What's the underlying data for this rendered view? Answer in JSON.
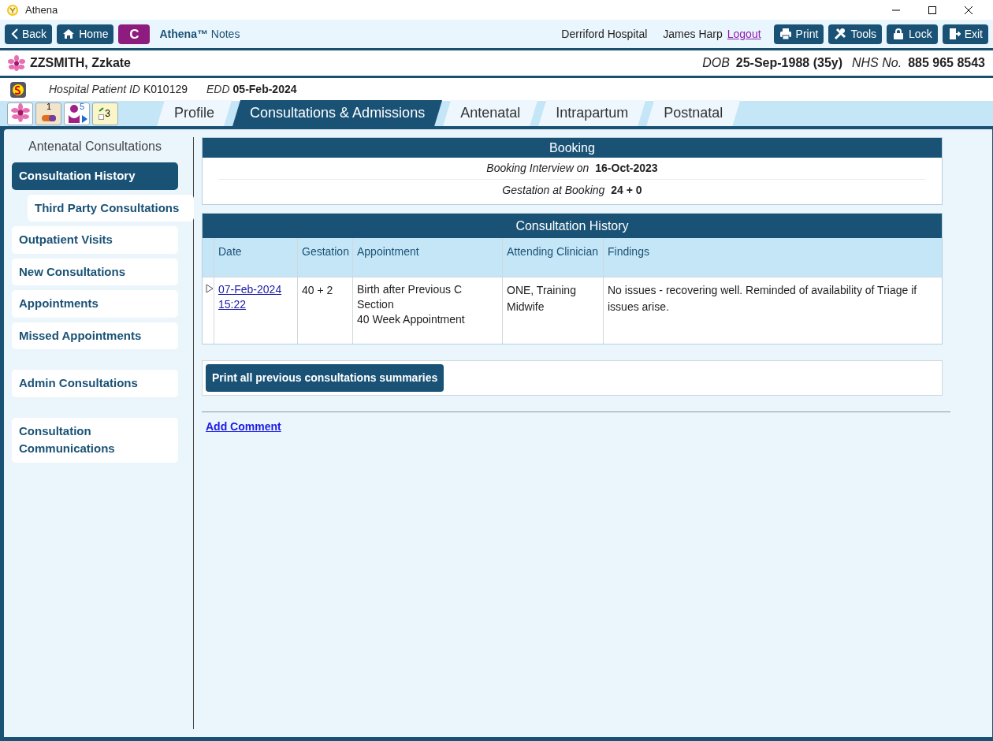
{
  "window": {
    "title": "Athena"
  },
  "toolbar": {
    "nav_buttons": [
      {
        "kind": "back",
        "label": "Back"
      },
      {
        "kind": "home",
        "label": "Home"
      }
    ],
    "badge": "C",
    "brand": "Athena™",
    "product": "Notes",
    "hospital": "Derriford Hospital",
    "user": "James Harp",
    "logout": "Logout",
    "actions": [
      {
        "kind": "print",
        "label": "Print"
      },
      {
        "kind": "tools",
        "label": "Tools"
      },
      {
        "kind": "lock",
        "label": "Lock"
      },
      {
        "kind": "exit",
        "label": "Exit"
      }
    ]
  },
  "patient": {
    "name": "ZZSMITH, Zzkate",
    "dob_label": "DOB",
    "dob": "25-Sep-1988 (35y)",
    "nhs_label": "NHS No.",
    "nhs": "885 965 8543"
  },
  "info": {
    "id_label": "Hospital Patient ID",
    "id": "K010129",
    "edd_label": "EDD",
    "edd": "05-Feb-2024"
  },
  "quick_icons": [
    {
      "kind": "flower"
    },
    {
      "kind": "pill",
      "count": "1"
    },
    {
      "kind": "person",
      "count": "5"
    },
    {
      "kind": "notes",
      "count": "3"
    }
  ],
  "tabs": [
    {
      "label": "Profile",
      "selected": false
    },
    {
      "label": "Consultations & Admissions",
      "selected": true
    },
    {
      "label": "Antenatal",
      "selected": false
    },
    {
      "label": "Intrapartum",
      "selected": false
    },
    {
      "label": "Postnatal",
      "selected": false
    }
  ],
  "sidebar": {
    "title": "Antenatal Consultations",
    "groups": [
      [
        {
          "label": "Consultation History",
          "selected": true,
          "children": [
            {
              "label": "Third Party Consultations",
              "selected": false
            }
          ]
        },
        {
          "label": "Outpatient Visits",
          "selected": false
        },
        {
          "label": "New Consultations",
          "selected": false
        },
        {
          "label": "Appointments",
          "selected": false
        },
        {
          "label": "Missed Appointments",
          "selected": false
        }
      ],
      [
        {
          "label": "Admin Consultations",
          "selected": false
        }
      ],
      [
        {
          "label": "Consultation Communications",
          "selected": false
        }
      ]
    ]
  },
  "booking": {
    "title": "Booking",
    "rows": [
      {
        "label": "Booking Interview on",
        "value": "16-Oct-2023"
      },
      {
        "label": "Gestation at Booking",
        "value": "24 + 0"
      }
    ]
  },
  "history": {
    "title": "Consultation History",
    "columns": [
      "Date",
      "Gestation",
      "Appointment",
      "Attending Clinician",
      "Findings"
    ],
    "rows": [
      {
        "date": "07-Feb-2024 15:22",
        "gestation": "40 + 2",
        "appointment": [
          "Birth after Previous C Section",
          "40 Week Appointment"
        ],
        "clinician": "ONE, Training Midwife",
        "findings": "No issues - recovering well. Reminded of availability of Triage if issues arise."
      }
    ]
  },
  "print_button": "Print all previous consultations summaries",
  "add_comment": "Add Comment"
}
